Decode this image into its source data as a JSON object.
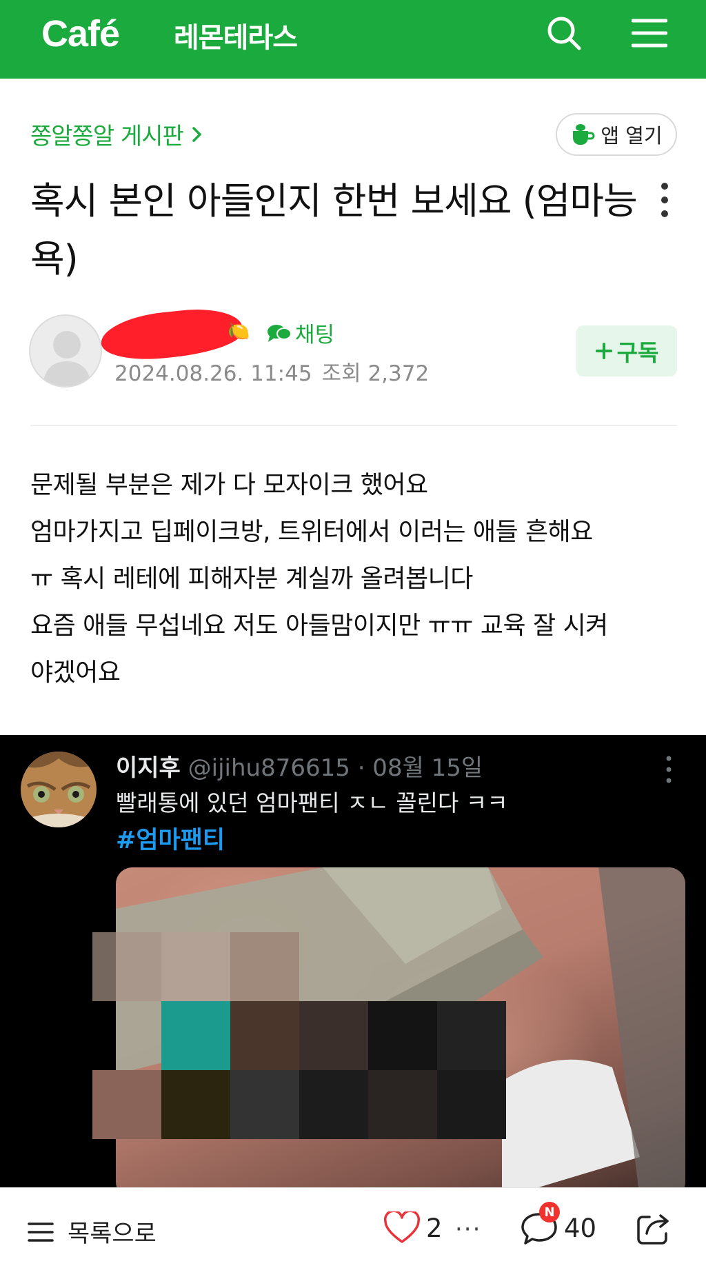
{
  "header": {
    "logo": "Café",
    "cafe_name": "레몬테라스"
  },
  "board": {
    "name": "쫑알쫑알 게시판",
    "app_open_label": "앱 열기"
  },
  "post": {
    "title": "혹시 본인 아들인지 한번 보세요 (엄마능욕)",
    "author_name": "[redacted]",
    "level_mark": "🍋",
    "chat_label": "채팅",
    "date": "2024.08.26. 11:45",
    "views_label": "조회 2,372",
    "subscribe_label": "구독",
    "body_lines": [
      "문제될 부분은 제가 다 모자이크 했어요",
      "엄마가지고 딥페이크방, 트위터에서 이러는 애들 흔해요",
      "ㅠ 혹시 레테에 피해자분 계실까 올려봅니다",
      "요즘 애들 무섭네요 저도 아들맘이지만 ㅠㅠ 교육 잘 시켜",
      "야겠어요"
    ]
  },
  "tweet": {
    "name": "이지후",
    "handle": "@ijihu876615 · 08월 15일",
    "text": "빨래통에 있던 엄마팬티 ㅈㄴ 꼴린다 ㅋㅋ",
    "hashtag": "#엄마팬티"
  },
  "bottom": {
    "list_label": "목록으로",
    "like_count": "2",
    "more_label": "···",
    "comment_badge": "N",
    "comment_count": "40"
  },
  "colors": {
    "brand_green": "#1aaa3d",
    "tweet_bg": "#000000",
    "hashtag_blue": "#1d9bf0",
    "badge_red": "#f0332f"
  },
  "icons": {
    "search": "search-icon",
    "menu": "hamburger-menu-icon",
    "app": "cup-icon",
    "chat": "chat-bubble-icon",
    "more": "more-vertical-icon",
    "like": "heart-icon",
    "comment": "comment-icon",
    "share": "share-icon",
    "list": "list-icon"
  }
}
